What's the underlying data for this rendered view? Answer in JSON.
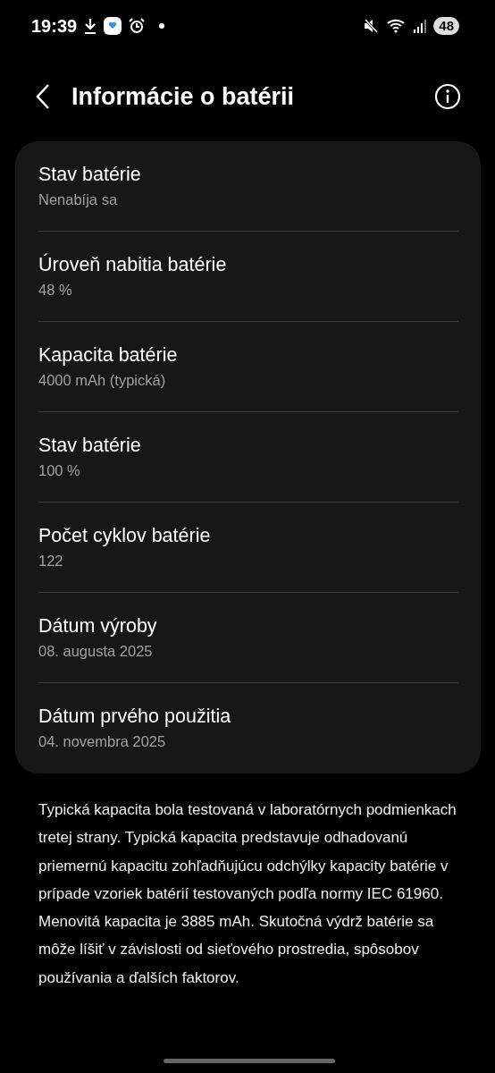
{
  "status_bar": {
    "time": "19:39",
    "battery": "48"
  },
  "header": {
    "title": "Informácie o batérii"
  },
  "items": [
    {
      "title": "Stav batérie",
      "value": "Nenabíja sa"
    },
    {
      "title": "Úroveň nabitia batérie",
      "value": "48 %"
    },
    {
      "title": "Kapacita batérie",
      "value": "4000 mAh (typická)"
    },
    {
      "title": "Stav batérie",
      "value": "100 %"
    },
    {
      "title": "Počet cyklov batérie",
      "value": "122"
    },
    {
      "title": "Dátum výroby",
      "value": "08. augusta 2025"
    },
    {
      "title": "Dátum prvého použitia",
      "value": "04. novembra 2025"
    }
  ],
  "note": "Typická kapacita bola testovaná v laboratórnych podmienkach tretej strany. Typická kapacita predstavuje odhadovanú priemernú kapacitu zohľadňujúcu odchýlky kapacity batérie v prípade vzoriek batérií testovaných podľa normy IEC 61960. Menovitá kapacita je 3885 mAh. Skutočná výdrž batérie sa môže líšiť v závislosti od sieťového prostredia, spôsobov používania a ďalších faktorov."
}
